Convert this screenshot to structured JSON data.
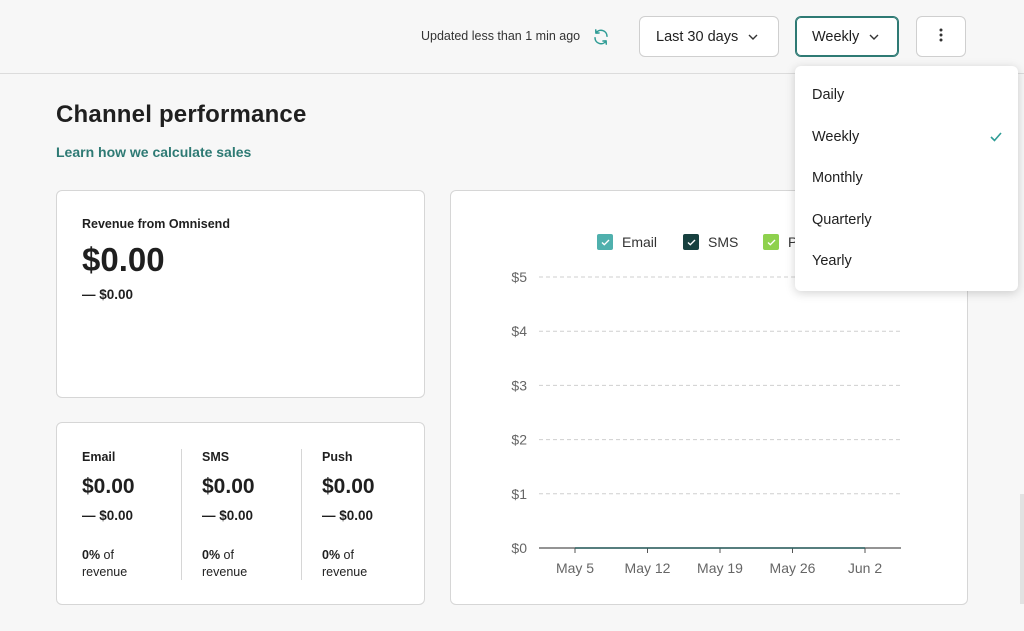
{
  "header": {
    "updated_text": "Updated less than 1 min ago",
    "date_range": "Last 30 days",
    "period": "Weekly"
  },
  "page": {
    "title": "Channel performance",
    "learn_link": "Learn how we calculate sales"
  },
  "revenue_card": {
    "label": "Revenue from Omnisend",
    "value": "$0.00",
    "comparison": "— $0.00"
  },
  "channels": [
    {
      "name": "Email",
      "value": "$0.00",
      "comparison": "— $0.00",
      "pct": "0%",
      "pct_suffix": " of revenue"
    },
    {
      "name": "SMS",
      "value": "$0.00",
      "comparison": "— $0.00",
      "pct": "0%",
      "pct_suffix": " of revenue"
    },
    {
      "name": "Push",
      "value": "$0.00",
      "comparison": "— $0.00",
      "pct": "0%",
      "pct_suffix": " of revenue"
    }
  ],
  "legend": [
    {
      "name": "Email",
      "color": "#4fb0ad"
    },
    {
      "name": "SMS",
      "color": "#17403f"
    },
    {
      "name": "P",
      "color": "#8ed14d"
    }
  ],
  "period_options": {
    "items": [
      "Daily",
      "Weekly",
      "Monthly",
      "Quarterly",
      "Yearly"
    ],
    "selected": "Weekly"
  },
  "colors": {
    "accent": "#2e7a74"
  },
  "chart_data": {
    "type": "line",
    "categories": [
      "May 5",
      "May 12",
      "May 19",
      "May 26",
      "Jun 2"
    ],
    "y_ticks": [
      "$0",
      "$1",
      "$2",
      "$3",
      "$4",
      "$5"
    ],
    "ylim": [
      0,
      5
    ],
    "grid": true,
    "legend_position": "top",
    "series": [
      {
        "name": "Email",
        "values": [
          0,
          0,
          0,
          0,
          0
        ]
      },
      {
        "name": "SMS",
        "values": [
          0,
          0,
          0,
          0,
          0
        ]
      }
    ]
  }
}
